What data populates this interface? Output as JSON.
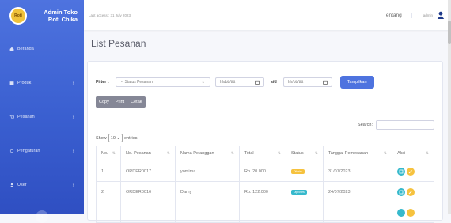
{
  "sidebar": {
    "brand_line1": "Admin Toko",
    "brand_line2": "Roti Chika",
    "logo_text": "Roti",
    "items": [
      {
        "label": "Beranda",
        "icon": "home-icon",
        "has_chevron": false
      },
      {
        "label": "Produk",
        "icon": "box-icon",
        "has_chevron": true
      },
      {
        "label": "Pesanan",
        "icon": "cart-icon",
        "has_chevron": true
      },
      {
        "label": "Pengaturan",
        "icon": "settings-icon",
        "has_chevron": true
      },
      {
        "label": "User",
        "icon": "users-icon",
        "has_chevron": true
      }
    ],
    "chevron": "›",
    "toggle": "‹"
  },
  "topbar": {
    "last_access": "Last access : 31 July 2023",
    "tentang": "Tentang",
    "user": "admin"
  },
  "page": {
    "title": "List Pesanan"
  },
  "filter": {
    "label": "Filter :",
    "status_value": "-- Status Pesanan",
    "date_from_placeholder": "hh/bb/tttt",
    "sd_label": "s/d",
    "date_to_placeholder": "hh/bb/tttt",
    "submit": "Tampilkan"
  },
  "export": {
    "copy": "Copy",
    "print": "Print",
    "cetak": "Cetak"
  },
  "table_controls": {
    "show": "Show",
    "entries_value": "10",
    "entries": "entries",
    "search": "Search:"
  },
  "table": {
    "headers": [
      "No.",
      "No. Pesanan",
      "Nama Pelanggan",
      "Total",
      "Status",
      "Tanggal Pemesanan",
      "Aksi"
    ],
    "rows": [
      {
        "no": "1",
        "order": "ORDER0017",
        "name": "yomima",
        "total": "Rp. 20.000",
        "status": "Dikirim",
        "status_type": "warn",
        "date": "31/07/2023"
      },
      {
        "no": "2",
        "order": "ORDER0016",
        "name": "Damy",
        "total": "Rp. 122.000",
        "status": "Diproses",
        "status_type": "info",
        "date": "24/07/2023"
      }
    ]
  },
  "colors": {
    "primary": "#4e73df",
    "info": "#36b9cc",
    "warning": "#f6c23e",
    "secondary": "#858796"
  }
}
